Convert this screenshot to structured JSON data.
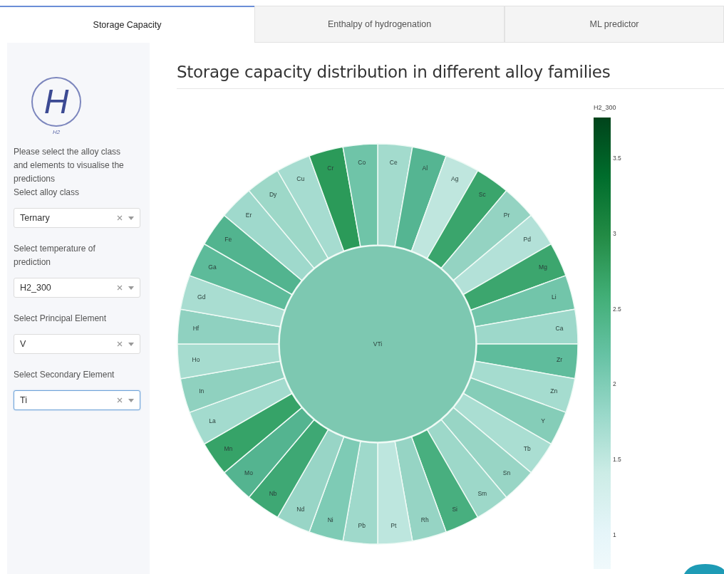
{
  "tabs": [
    {
      "label": "Storage Capacity",
      "selected": true
    },
    {
      "label": "Enthalpy of hydrogenation",
      "selected": false
    },
    {
      "label": "ML predictor",
      "selected": false
    }
  ],
  "sidebar": {
    "logo": {
      "letter": "H",
      "caption": "H2"
    },
    "intro": "Please select the alloy class and elements to visualise the predictions",
    "controls": [
      {
        "label": "Select alloy class",
        "value": "Ternary",
        "focused": false
      },
      {
        "label": "Select temperature of prediction",
        "value": "H2_300",
        "focused": false
      },
      {
        "label": "Select Principal Element",
        "value": "V",
        "focused": false
      },
      {
        "label": "Select Secondary Element",
        "value": "Ti",
        "focused": true
      }
    ]
  },
  "main": {
    "title": "Storage capacity distribution in different alloy families",
    "sunburst": {
      "center": {
        "label": "VTi",
        "color": "#7dc8b1"
      },
      "segments": [
        {
          "label": "Ce",
          "color": "#a3dbcd"
        },
        {
          "label": "Al",
          "color": "#55b592"
        },
        {
          "label": "Ag",
          "color": "#bfe6de"
        },
        {
          "label": "Sc",
          "color": "#3aa56c"
        },
        {
          "label": "Pr",
          "color": "#94d3c2"
        },
        {
          "label": "Pd",
          "color": "#b3e1d8"
        },
        {
          "label": "Mg",
          "color": "#3ca66e"
        },
        {
          "label": "Li",
          "color": "#72c5aa"
        },
        {
          "label": "Ca",
          "color": "#9dd8ca"
        },
        {
          "label": "Zr",
          "color": "#5fbc9c"
        },
        {
          "label": "Zn",
          "color": "#a5dccf"
        },
        {
          "label": "Y",
          "color": "#85cdb8"
        },
        {
          "label": "Tb",
          "color": "#aaded2"
        },
        {
          "label": "Sn",
          "color": "#98d5c5"
        },
        {
          "label": "Sm",
          "color": "#9dd8c9"
        },
        {
          "label": "Si",
          "color": "#48af7f"
        },
        {
          "label": "Rh",
          "color": "#96d4c4"
        },
        {
          "label": "Pt",
          "color": "#bde6de"
        },
        {
          "label": "Pb",
          "color": "#9fd9cb"
        },
        {
          "label": "Ni",
          "color": "#7ecbb5"
        },
        {
          "label": "Nd",
          "color": "#98d5c6"
        },
        {
          "label": "Nb",
          "color": "#3ea874"
        },
        {
          "label": "Mo",
          "color": "#54b490"
        },
        {
          "label": "Mn",
          "color": "#36a368"
        },
        {
          "label": "La",
          "color": "#a3dbce"
        },
        {
          "label": "In",
          "color": "#8fd1bf"
        },
        {
          "label": "Ho",
          "color": "#a6dccf"
        },
        {
          "label": "Hf",
          "color": "#8fd1c0"
        },
        {
          "label": "Gd",
          "color": "#a9ddd1"
        },
        {
          "label": "Ga",
          "color": "#5dbb9a"
        },
        {
          "label": "Fe",
          "color": "#52b48f"
        },
        {
          "label": "Er",
          "color": "#9fd9cc"
        },
        {
          "label": "Dy",
          "color": "#9dd8c8"
        },
        {
          "label": "Cu",
          "color": "#a6dcd0"
        },
        {
          "label": "Cr",
          "color": "#2b9a59"
        },
        {
          "label": "Co",
          "color": "#6fc4a8"
        }
      ]
    },
    "colorbar": {
      "title": "H2_300",
      "ticks": [
        "3.5",
        "3",
        "2.5",
        "2",
        "1.5",
        "1"
      ]
    }
  }
}
